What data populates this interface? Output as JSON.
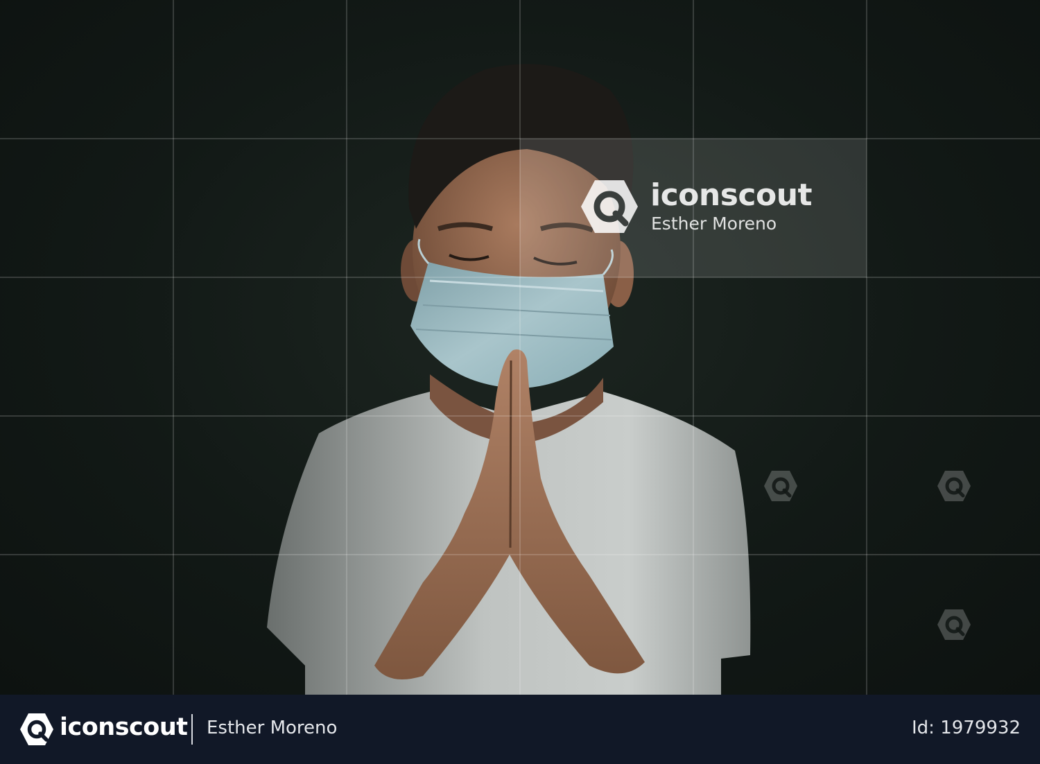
{
  "watermark": {
    "brand": "iconscout",
    "author": "Esther Moreno",
    "logo_icon": "iconscout-logo-icon"
  },
  "footer": {
    "brand": "iconscout",
    "author": "Esther Moreno",
    "id_text": "Id: 1979932",
    "background": "#111827"
  },
  "photo": {
    "subject_icon": "praying-masked-child-photo"
  }
}
